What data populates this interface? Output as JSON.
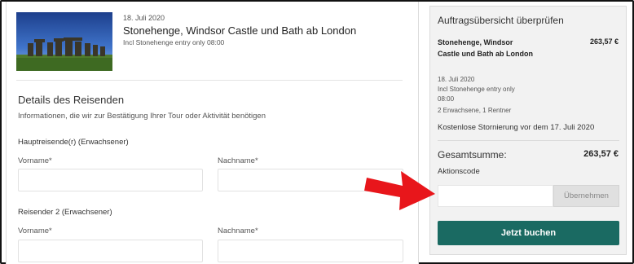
{
  "tour": {
    "date": "18. Juli 2020",
    "title": "Stonehenge, Windsor Castle und Bath ab London",
    "subtitle": "Incl Stonehenge entry only 08:00",
    "image_icon": "stonehenge-photo"
  },
  "details": {
    "title": "Details des Reisenden",
    "description": "Informationen, die wir zur Bestätigung Ihrer Tour oder Aktivität benötigen",
    "travelers": [
      {
        "label": "Hauptreisende(r) (Erwachsener)",
        "first_name_label": "Vorname*",
        "last_name_label": "Nachname*",
        "first_name_value": "",
        "last_name_value": ""
      },
      {
        "label": "Reisender 2 (Erwachsener)",
        "first_name_label": "Vorname*",
        "last_name_label": "Nachname*",
        "first_name_value": "",
        "last_name_value": ""
      }
    ]
  },
  "summary": {
    "heading": "Auftragsübersicht überprüfen",
    "tour_title": "Stonehenge, Windsor Castle und Bath ab London",
    "price": "263,57 €",
    "date": "18. Juli 2020",
    "option_line1": "Incl Stonehenge entry only",
    "option_line2": "08:00",
    "participants": "2 Erwachsene, 1 Rentner",
    "cancellation": "Kostenlose Stornierung vor dem 17. Juli 2020",
    "total_label": "Gesamtsumme:",
    "total_value": "263,57 €",
    "promo_label": "Aktionscode",
    "promo_value": "",
    "promo_button": "Übernehmen",
    "book_button": "Jetzt buchen"
  },
  "colors": {
    "accent": "#1a6a62",
    "arrow": "#e8161b"
  }
}
